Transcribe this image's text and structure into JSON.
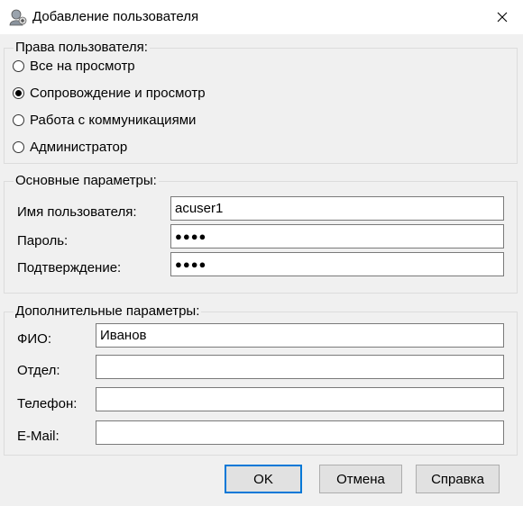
{
  "window": {
    "title": "Добавление пользователя"
  },
  "rights": {
    "title": "Права пользователя:",
    "options": [
      {
        "label": "Все на просмотр",
        "selected": false
      },
      {
        "label": "Сопровождение и просмотр",
        "selected": true
      },
      {
        "label": "Работа с коммуникациями",
        "selected": false
      },
      {
        "label": "Администратор",
        "selected": false
      }
    ]
  },
  "main_params": {
    "title": "Основные параметры:",
    "username_label": "Имя пользователя:",
    "username_value": "acuser1",
    "password_label": "Пароль:",
    "password_value": "●●●●",
    "confirm_label": "Подтверждение:",
    "confirm_value": "●●●●"
  },
  "extra_params": {
    "title": "Дополнительные параметры:",
    "fio_label": "ФИО:",
    "fio_value": "Иванов",
    "dept_label": "Отдел:",
    "dept_value": "",
    "phone_label": "Телефон:",
    "phone_value": "",
    "email_label": "E-Mail:",
    "email_value": ""
  },
  "buttons": {
    "ok": "OK",
    "cancel": "Отмена",
    "help": "Справка"
  }
}
